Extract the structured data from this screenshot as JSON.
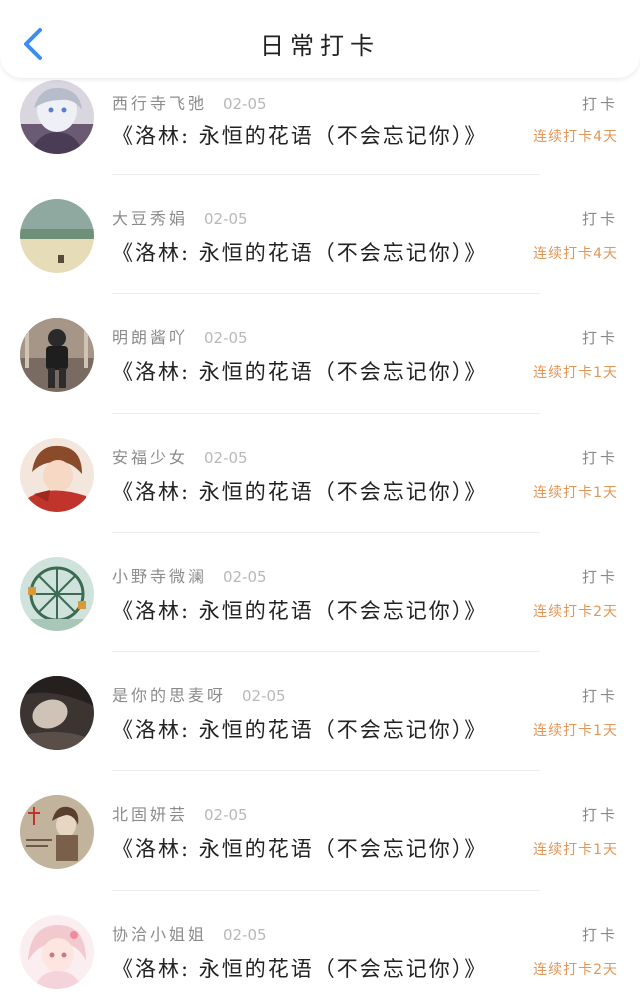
{
  "header": {
    "title": "日常打卡",
    "back_icon": "chevron-left-icon",
    "accent_color": "#3d8cf0"
  },
  "colors": {
    "streak": "#e39656",
    "name": "#8b8b8b",
    "date": "#b8b8b8"
  },
  "entries": [
    {
      "name": "西行寺飞弛",
      "date": "02-05",
      "song": "《洛林: 永恒的花语（不会忘记你）》",
      "action": "打卡",
      "streak": "连续打卡4天",
      "avatar": "avatar-silver-hair"
    },
    {
      "name": "大豆秀娟",
      "date": "02-05",
      "song": "《洛林: 永恒的花语（不会忘记你）》",
      "action": "打卡",
      "streak": "连续打卡4天",
      "avatar": "avatar-lake-landscape"
    },
    {
      "name": "明朗酱吖",
      "date": "02-05",
      "song": "《洛林: 永恒的花语（不会忘记你）》",
      "action": "打卡",
      "streak": "连续打卡1天",
      "avatar": "avatar-hoodie-figure"
    },
    {
      "name": "安福少女",
      "date": "02-05",
      "song": "《洛林: 永恒的花语（不会忘记你）》",
      "action": "打卡",
      "streak": "连续打卡1天",
      "avatar": "avatar-red-scarf"
    },
    {
      "name": "小野寺微澜",
      "date": "02-05",
      "song": "《洛林: 永恒的花语（不会忘记你）》",
      "action": "打卡",
      "streak": "连续打卡2天",
      "avatar": "avatar-ferris-wheel"
    },
    {
      "name": "是你的思麦呀",
      "date": "02-05",
      "song": "《洛林: 永恒的花语（不会忘记你）》",
      "action": "打卡",
      "streak": "连续打卡1天",
      "avatar": "avatar-dark-portrait"
    },
    {
      "name": "北固妍芸",
      "date": "02-05",
      "song": "《洛林: 永恒的花语（不会忘记你）》",
      "action": "打卡",
      "streak": "连续打卡1天",
      "avatar": "avatar-sepia-girl"
    },
    {
      "name": "协洽小姐姐",
      "date": "02-05",
      "song": "《洛林: 永恒的花语（不会忘记你）》",
      "action": "打卡",
      "streak": "连续打卡2天",
      "avatar": "avatar-anime-pink"
    }
  ]
}
